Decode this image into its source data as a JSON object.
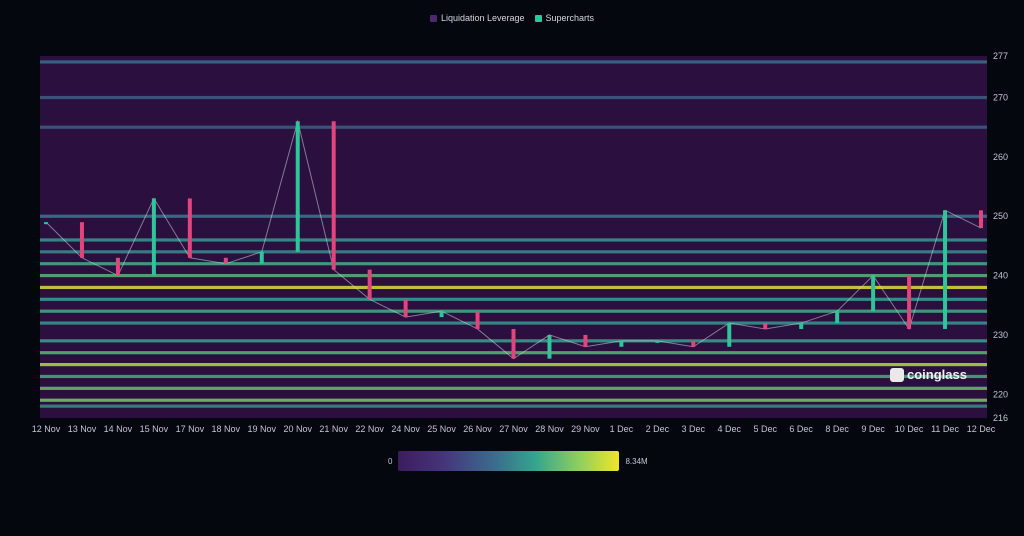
{
  "legend": [
    {
      "label": "Liquidation Leverage",
      "color": "#4b2a6f"
    },
    {
      "label": "Supercharts",
      "color": "#2fc49a"
    }
  ],
  "scale": {
    "min_label": "0",
    "max_label": "8.34M"
  },
  "brand": {
    "name": "coinglass"
  },
  "chart_data": {
    "type": "heatmap",
    "title": "",
    "xlabel": "",
    "ylabel": "",
    "x_ticks": [
      "12 Nov",
      "13 Nov",
      "14 Nov",
      "15 Nov",
      "17 Nov",
      "18 Nov",
      "19 Nov",
      "20 Nov",
      "21 Nov",
      "22 Nov",
      "24 Nov",
      "25 Nov",
      "26 Nov",
      "27 Nov",
      "28 Nov",
      "29 Nov",
      "1 Dec",
      "2 Dec",
      "3 Dec",
      "4 Dec",
      "5 Dec",
      "6 Dec",
      "8 Dec",
      "9 Dec",
      "10 Dec",
      "11 Dec",
      "12 Dec"
    ],
    "y_ticks": [
      216,
      220,
      230,
      240,
      250,
      260,
      270,
      277
    ],
    "ylim": [
      216,
      277
    ],
    "colorscale": {
      "min": 0,
      "max": "8.34M",
      "colors": [
        "#3b1d5c",
        "#3b6f8e",
        "#33a58e",
        "#8fcf5c",
        "#f0e52a"
      ]
    },
    "candles": [
      {
        "date": "12 Nov",
        "close": 249
      },
      {
        "date": "13 Nov",
        "close": 243
      },
      {
        "date": "14 Nov",
        "close": 240
      },
      {
        "date": "15 Nov",
        "close": 253
      },
      {
        "date": "17 Nov",
        "close": 243
      },
      {
        "date": "18 Nov",
        "close": 242
      },
      {
        "date": "19 Nov",
        "close": 244
      },
      {
        "date": "20 Nov",
        "close": 266
      },
      {
        "date": "21 Nov",
        "close": 241
      },
      {
        "date": "22 Nov",
        "close": 236
      },
      {
        "date": "24 Nov",
        "close": 233
      },
      {
        "date": "25 Nov",
        "close": 234
      },
      {
        "date": "26 Nov",
        "close": 231
      },
      {
        "date": "27 Nov",
        "close": 226
      },
      {
        "date": "28 Nov",
        "close": 230
      },
      {
        "date": "29 Nov",
        "close": 228
      },
      {
        "date": "1 Dec",
        "close": 229
      },
      {
        "date": "2 Dec",
        "close": 229
      },
      {
        "date": "3 Dec",
        "close": 228
      },
      {
        "date": "4 Dec",
        "close": 232
      },
      {
        "date": "5 Dec",
        "close": 231
      },
      {
        "date": "6 Dec",
        "close": 232
      },
      {
        "date": "8 Dec",
        "close": 234
      },
      {
        "date": "9 Dec",
        "close": 240
      },
      {
        "date": "10 Dec",
        "close": 231
      },
      {
        "date": "11 Dec",
        "close": 251
      },
      {
        "date": "12 Dec",
        "close": 248
      }
    ],
    "liquidation_bands": [
      {
        "price": 276,
        "intensity": 0.25
      },
      {
        "price": 270,
        "intensity": 0.2
      },
      {
        "price": 265,
        "intensity": 0.2
      },
      {
        "price": 250,
        "intensity": 0.3
      },
      {
        "price": 246,
        "intensity": 0.45
      },
      {
        "price": 244,
        "intensity": 0.4
      },
      {
        "price": 242,
        "intensity": 0.55
      },
      {
        "price": 240,
        "intensity": 0.6
      },
      {
        "price": 238,
        "intensity": 0.95
      },
      {
        "price": 236,
        "intensity": 0.5
      },
      {
        "price": 234,
        "intensity": 0.55
      },
      {
        "price": 232,
        "intensity": 0.45
      },
      {
        "price": 229,
        "intensity": 0.5
      },
      {
        "price": 227,
        "intensity": 0.6
      },
      {
        "price": 225,
        "intensity": 0.85
      },
      {
        "price": 223,
        "intensity": 0.55
      },
      {
        "price": 221,
        "intensity": 0.65
      },
      {
        "price": 219,
        "intensity": 0.7
      },
      {
        "price": 218,
        "intensity": 0.4
      }
    ]
  }
}
